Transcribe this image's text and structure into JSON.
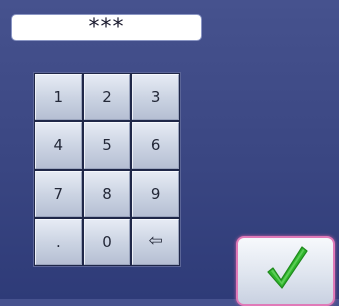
{
  "pin": {
    "masked_value": "***"
  },
  "keypad": {
    "keys": [
      "1",
      "2",
      "3",
      "4",
      "5",
      "6",
      "7",
      "8",
      "9",
      ".",
      "0",
      "⇦"
    ]
  },
  "confirm": {
    "icon": "checkmark-icon",
    "color": "#2fb52c"
  },
  "colors": {
    "background": "#3a4682",
    "accent_border": "#e07ab8"
  }
}
